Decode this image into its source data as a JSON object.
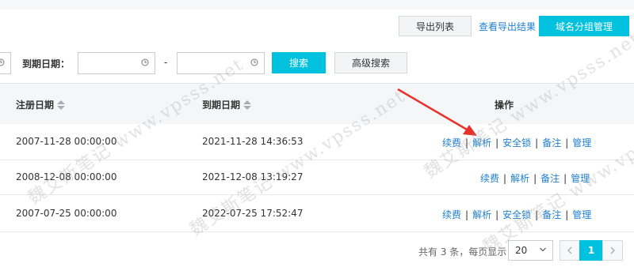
{
  "toolbar": {
    "export_list": "导出列表",
    "view_export_result": "查看导出结果",
    "domain_group_manage": "域名分组管理"
  },
  "search": {
    "expiry_date_label": "到期日期：",
    "range_sep": "-",
    "search_button": "搜索",
    "advanced_search": "高级搜索"
  },
  "table": {
    "headers": {
      "register_date": "注册日期",
      "expire_date": "到期日期",
      "operation": "操作"
    },
    "rows": [
      {
        "register": "2007-11-28 00:00:00",
        "expire": "2021-11-28 14:36:53"
      },
      {
        "register": "2008-12-08 00:00:00",
        "expire": "2021-12-08 13:19:27"
      },
      {
        "register": "2007-07-25 00:00:00",
        "expire": "2022-07-25 17:52:47"
      }
    ],
    "actions": {
      "renew": "续费",
      "resolve": "解析",
      "security_lock": "安全锁",
      "note": "备注",
      "manage": "管理",
      "sep": "|"
    }
  },
  "pagination": {
    "summary": "共有 3 条，每页显示：",
    "page_size": "20",
    "current_page": "1"
  },
  "watermark": {
    "text": "魏艾斯笔记 www.vpsss.net"
  },
  "colors": {
    "accent": "#00c1de",
    "link": "#1f7fd0",
    "arrow": "#e8322b"
  }
}
